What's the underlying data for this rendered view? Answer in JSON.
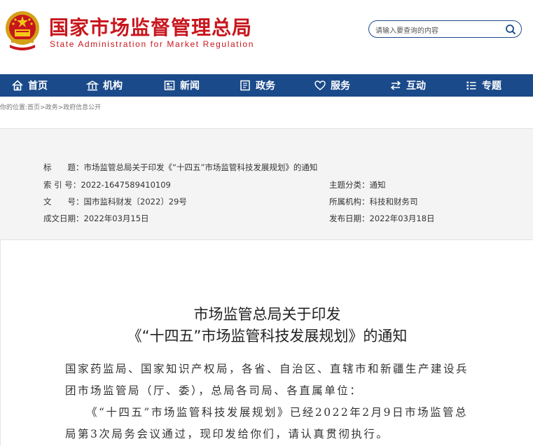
{
  "header": {
    "title": "国家市场监督管理总局",
    "subtitle": "State Administration for Market Regulation",
    "search_placeholder": "请输入要查询的内容",
    "brand_color": "#c8161d"
  },
  "nav": {
    "bg_color": "#1a4a8a",
    "items": [
      {
        "label": "首页",
        "icon": "home-icon"
      },
      {
        "label": "机构",
        "icon": "building-icon"
      },
      {
        "label": "新闻",
        "icon": "newspaper-icon"
      },
      {
        "label": "政务",
        "icon": "document-icon"
      },
      {
        "label": "服务",
        "icon": "heart-icon"
      },
      {
        "label": "互动",
        "icon": "exchange-icon"
      },
      {
        "label": "专题",
        "icon": "list-icon"
      }
    ]
  },
  "breadcrumb": "你的位置:首页>政务>政府信息公开",
  "info": {
    "title_label": "标　　题：",
    "title_value": "市场监管总局关于印发《“十四五”市场监管科技发展规划》的通知",
    "index_label": "索 引 号：",
    "index_value": "2022-1647589410109",
    "topic_label": "主题分类：",
    "topic_value": "通知",
    "docno_label": "文　　号：",
    "docno_value": "国市监科财发〔2022〕29号",
    "org_label": "所属机构：",
    "org_value": "科技和财务司",
    "created_label": "成文日期：",
    "created_value": "2022年03月15日",
    "published_label": "发布日期：",
    "published_value": "2022年03月18日"
  },
  "article": {
    "title_line1": "市场监管总局关于印发",
    "title_line2": "《“十四五”市场监管科技发展规划》的通知",
    "para1_line1": "国家药监局、国家知识产权局，各省、自治区、直辖市和新疆生产建设兵",
    "para1_line2": "团市场监管局（厅、委），总局各司局、各直属单位：",
    "para2_line1": "《“十四五”市场监管科技发展规划》已经2022年2月9日市场监管总",
    "para2_line2": "局第3次局务会议通过，现印发给你们，请认真贯彻执行。"
  }
}
